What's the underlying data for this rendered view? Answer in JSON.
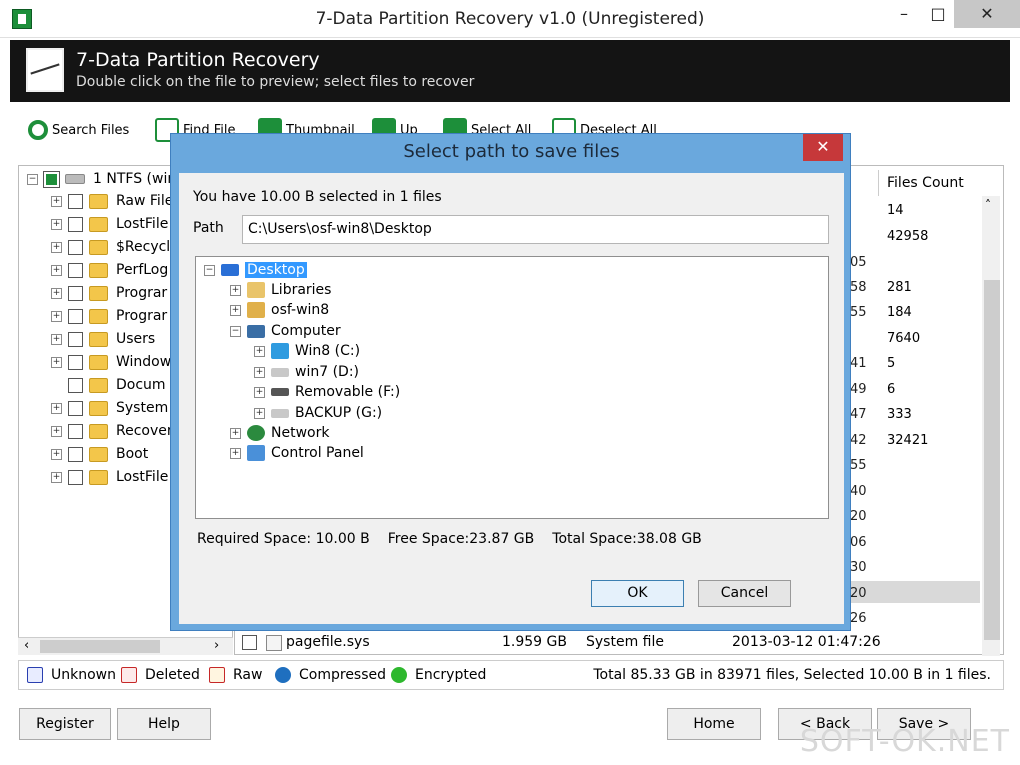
{
  "window": {
    "title": "7-Data Partition Recovery v1.0 (Unregistered)"
  },
  "header": {
    "title": "7-Data Partition Recovery",
    "subtitle": "Double click on the file to preview; select files to recover"
  },
  "toolbar": [
    {
      "label": "Search Files"
    },
    {
      "label": "Find File"
    },
    {
      "label": "Thumbnail"
    },
    {
      "label": "Up"
    },
    {
      "label": "Select All"
    },
    {
      "label": "Deselect All"
    }
  ],
  "left_tree": {
    "root": "1 NTFS (win",
    "items": [
      "Raw File",
      "LostFile",
      "$Recycl",
      "PerfLog",
      "Prograr",
      "Prograr",
      "Users",
      "Window",
      "Docum",
      "System",
      "Recover",
      "Boot",
      "LostFile"
    ]
  },
  "files_count": {
    "header": "Files Count",
    "values": [
      "14",
      "42958",
      "",
      "281",
      "184",
      "7640",
      "5",
      "6",
      "333",
      "32421"
    ]
  },
  "bg_col": [
    "05",
    "58",
    "55",
    "",
    "41",
    "49",
    "47",
    "42",
    "55",
    "40",
    "20",
    "06",
    "30",
    "20",
    "26"
  ],
  "pagefile_row": {
    "name": "pagefile.sys",
    "size": "1.959 GB",
    "type": "System file",
    "date": "2013-03-12 01:47:26"
  },
  "legend": {
    "unknown": "Unknown",
    "deleted": "Deleted",
    "raw": "Raw",
    "compressed": "Compressed",
    "encrypted": "Encrypted"
  },
  "status": "Total 85.33 GB in 83971 files, Selected 10.00 B in 1 files.",
  "buttons": {
    "register": "Register",
    "help": "Help",
    "home": "Home",
    "back": "< Back",
    "save": "Save >"
  },
  "dialog": {
    "title": "Select path to save files",
    "info": "You have 10.00 B selected in 1 files",
    "path_label": "Path",
    "path_value": "C:\\Users\\osf-win8\\Desktop",
    "tree": {
      "desktop": "Desktop",
      "libraries": "Libraries",
      "user": "osf-win8",
      "computer": "Computer",
      "c": "Win8 (C:)",
      "d": "win7 (D:)",
      "f": "Removable (F:)",
      "g": "BACKUP (G:)",
      "network": "Network",
      "control": "Control Panel"
    },
    "required": "Required Space: 10.00 B",
    "free": "Free Space:23.87 GB",
    "total": "Total Space:38.08 GB",
    "ok": "OK",
    "cancel": "Cancel"
  },
  "watermark": "SOFT-OK.NET",
  "colors": {
    "header_bg": "#141414",
    "dialog_frame": "#6aa8dd",
    "dialog_close": "#c6383a",
    "selection": "#3399ff",
    "toolbar_icon": "#1d8f3a"
  }
}
